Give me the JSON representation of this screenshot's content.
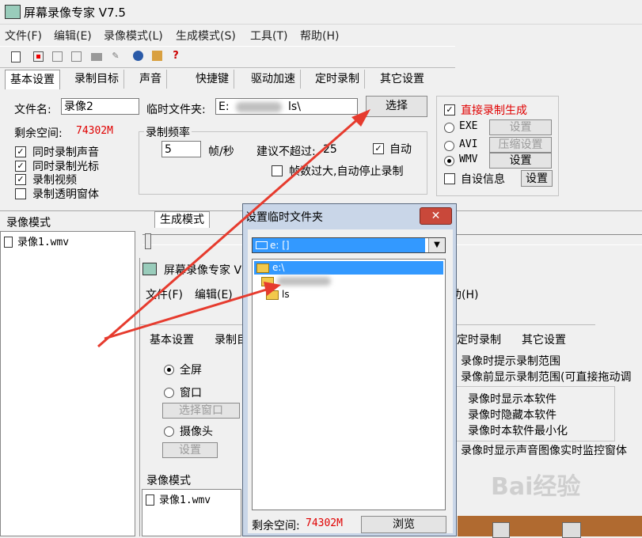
{
  "window": {
    "title": "屏幕录像专家 V7.5"
  },
  "menu": [
    "文件(F)",
    "编辑(E)",
    "录像模式(L)",
    "生成模式(S)",
    "工具(T)",
    "帮助(H)"
  ],
  "toolbar": {
    "icons": [
      "new-icon",
      "record-icon",
      "pause-icon",
      "stop-icon",
      "camera-icon",
      "pen-icon",
      "globe-icon",
      "info-icon",
      "help-icon"
    ],
    "help_glyph": "?"
  },
  "tabs": [
    "基本设置",
    "录制目标",
    "声音",
    "快捷键",
    "驱动加速",
    "定时录制",
    "其它设置"
  ],
  "basic": {
    "filename_label": "文件名:",
    "filename_value": "录像2",
    "tempdir_label": "临时文件夹:",
    "tempdir_value_start": "E:",
    "tempdir_value_end": "ls\\",
    "select_button": "选择",
    "free_space_label": "剩余空间:",
    "free_space_value": "74302M",
    "checks": [
      {
        "label": "同时录制声音",
        "checked": true
      },
      {
        "label": "同时录制光标",
        "checked": true
      },
      {
        "label": "录制视频",
        "checked": true
      },
      {
        "label": "录制透明窗体",
        "checked": false
      }
    ],
    "rate_group": "录制频率",
    "fps_value": "5",
    "fps_unit": "帧/秒",
    "suggest_label": "建议不超过:",
    "suggest_value": "25",
    "auto_label": "自动",
    "auto_stop_label": "帧数过大,自动停止录制"
  },
  "gen": {
    "direct_label": "直接录制生成",
    "options": [
      {
        "label": "EXE",
        "button": "设置",
        "selected": false,
        "enabled": false
      },
      {
        "label": "AVI",
        "button": "压缩设置",
        "selected": false,
        "enabled": false
      },
      {
        "label": "WMV",
        "button": "设置",
        "selected": true,
        "enabled": true
      }
    ],
    "custom_info_label": "自设信息",
    "custom_info_button": "设置"
  },
  "lower": {
    "record_mode_tab": "录像模式",
    "gen_mode_tab": "生成模式",
    "file_item": "录像1.wmv"
  },
  "dialog": {
    "title": "设置临时文件夹",
    "close": "✕",
    "drive": "e: []",
    "folders": [
      "e:\\",
      "",
      "ls"
    ],
    "free_space_label": "剩余空间:",
    "free_space_value": "74302M",
    "browse_button": "浏览"
  },
  "bg_window": {
    "title": "屏幕录像专家 V",
    "menu_left": [
      "文件(F)",
      "编辑(E)"
    ],
    "menu_right": "助(H)",
    "tabs_left": [
      "基本设置",
      "录制目"
    ],
    "tabs_right": [
      "定时录制",
      "其它设置"
    ],
    "radio_fullscreen": "全屏",
    "radio_window": "窗口",
    "select_window_btn": "选择窗口",
    "radio_camera": "摄像头",
    "camera_settings_btn": "设置",
    "record_mode_label": "录像模式",
    "file_item": "录像1.wmv",
    "right_lines": [
      "录像时提示录制范围",
      "录像前显示录制范围(可直接拖动调",
      "录像时显示本软件",
      "录像时隐藏本软件",
      "录像时本软件最小化",
      "录像时显示声音图像实时监控窗体"
    ]
  },
  "watermark": "Bai经验",
  "colors": {
    "accent_red": "#e00000",
    "selection_blue": "#3399ff",
    "arrow_red": "#e63b2e",
    "dialog_frame": "#c9d6e8",
    "close_red": "#c9483a"
  }
}
